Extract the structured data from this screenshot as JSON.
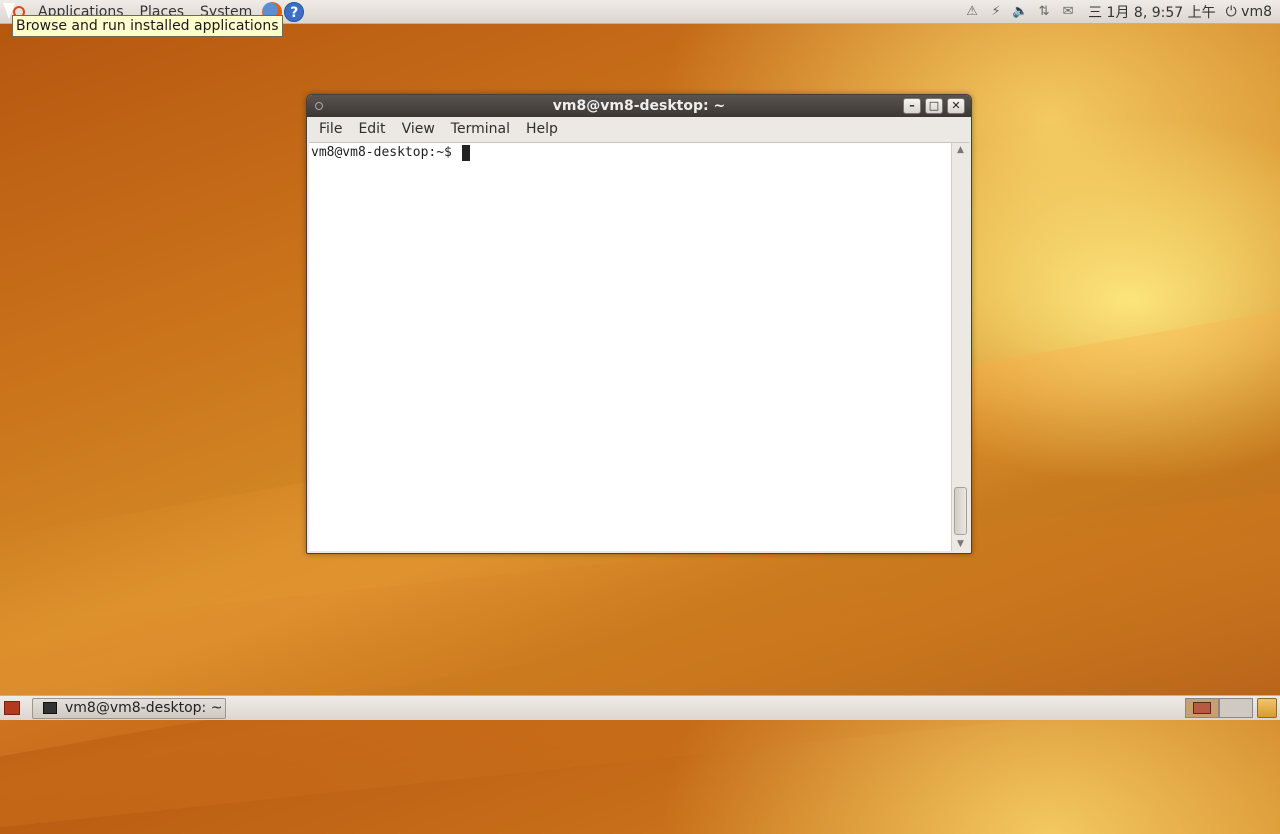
{
  "top_panel": {
    "menus": [
      "Applications",
      "Places",
      "System"
    ],
    "tooltip": "Browse and run installed applications",
    "clock": "三 1月  8, 9:57 上午",
    "user": "vm8",
    "tray_icons": [
      "alert-icon",
      "network-icon",
      "volume-icon",
      "network-manager-icon",
      "mail-icon"
    ]
  },
  "window": {
    "title": "vm8@vm8-desktop: ~",
    "menu": [
      "File",
      "Edit",
      "View",
      "Terminal",
      "Help"
    ],
    "prompt": "vm8@vm8-desktop:~$ "
  },
  "taskbar": {
    "task_label": "vm8@vm8-desktop: ~"
  },
  "colors": {
    "panel": "#dcd6cf",
    "titlebar": "#3c3733",
    "desktop": "#c8701a",
    "tooltip": "#fffdcc"
  }
}
